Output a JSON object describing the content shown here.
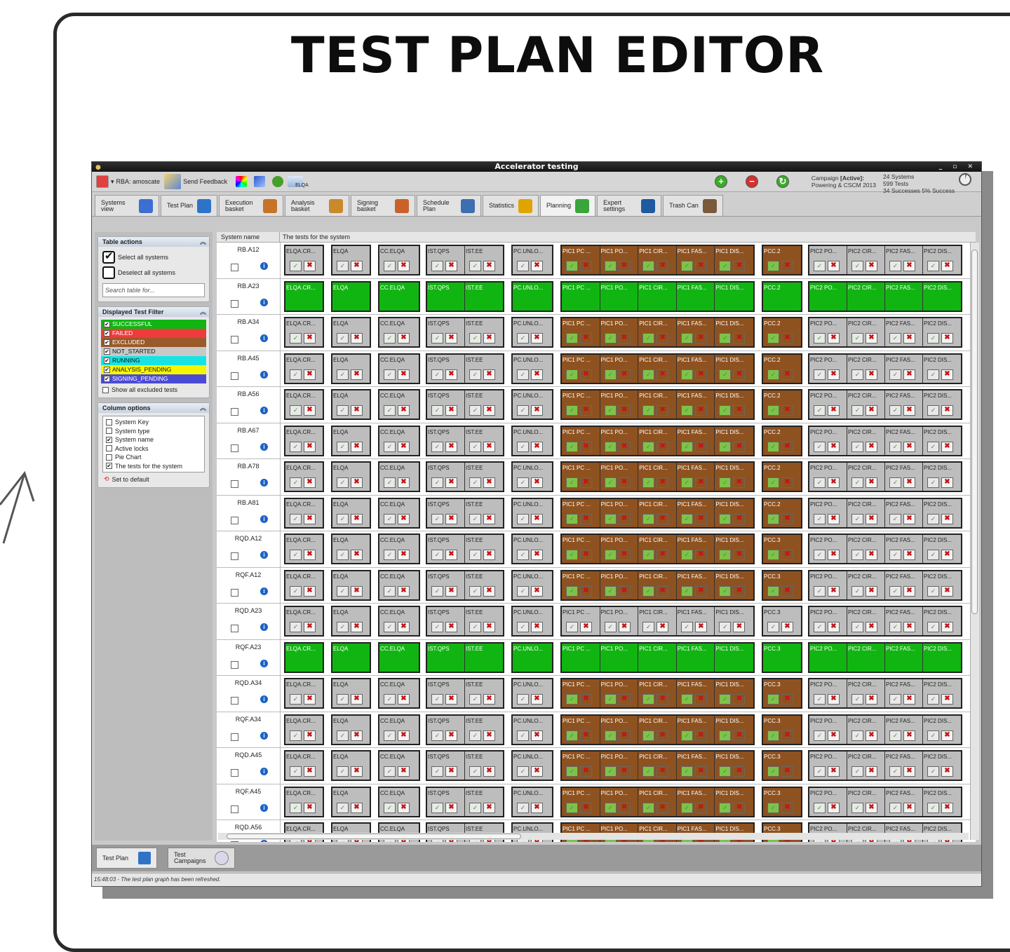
{
  "page_title": "TEST PLAN EDITOR",
  "window": {
    "title": "Accelerator testing",
    "controls": "_ ▫ ✕"
  },
  "toolbar": {
    "user": "RBA: amoscate",
    "send_feedback": "Send Feedback",
    "elqa": "ELQA",
    "campaign_label": "Campaign",
    "campaign_state": "[Active]:",
    "campaign_name": "Powering & CSCM 2013",
    "stats": {
      "systems": "24 Systems",
      "tests": "599 Tests",
      "successes": "34 Successes",
      "percent": "5% Success"
    }
  },
  "tabs": [
    {
      "label": "Systems view",
      "icon": "systems-view-icon",
      "color": "#3b6fd1"
    },
    {
      "label": "Test Plan",
      "icon": "test-plan-icon",
      "color": "#2f73c9"
    },
    {
      "label": "Execution basket",
      "icon": "execution-basket-icon",
      "color": "#c9722a"
    },
    {
      "label": "Analysis basket",
      "icon": "analysis-basket-icon",
      "color": "#c98a2a"
    },
    {
      "label": "Signing basket",
      "icon": "signing-basket-icon",
      "color": "#c9622a"
    },
    {
      "label": "Schedule Plan",
      "icon": "schedule-plan-icon",
      "color": "#3b6fb0"
    },
    {
      "label": "Statistics",
      "icon": "statistics-icon",
      "color": "#e0a400"
    },
    {
      "label": "Planning",
      "icon": "planning-icon",
      "color": "#3aa53a"
    },
    {
      "label": "Expert settings",
      "icon": "gear-icon",
      "color": "#1e5aa0"
    },
    {
      "label": "Trash Can",
      "icon": "trash-can-icon",
      "color": "#7a5a3a"
    }
  ],
  "table_actions": {
    "title": "Table actions",
    "select_all": "Select all systems",
    "deselect_all": "Deselect all systems",
    "search_placeholder": "Search table for..."
  },
  "test_filter": {
    "title": "Displayed Test Filter",
    "items": [
      {
        "label": "SUCCESSFUL",
        "color": "#11b511",
        "checked": true
      },
      {
        "label": "FAILED",
        "color": "#ef3b3b",
        "checked": true
      },
      {
        "label": "EXCLUDED",
        "color": "#9a5a2a",
        "checked": true
      },
      {
        "label": "NOT_STARTED",
        "color": "#c8c8c8",
        "checked": true
      },
      {
        "label": "RUNNING",
        "color": "#17e3e3",
        "checked": true
      },
      {
        "label": "ANALYSIS_PENDING",
        "color": "#f5f500",
        "checked": true
      },
      {
        "label": "SIGNING_PENDING",
        "color": "#4b4bd6",
        "checked": true
      }
    ],
    "show_excluded": "Show all excluded tests"
  },
  "column_options": {
    "title": "Column options",
    "items": [
      {
        "label": "System Key",
        "checked": false
      },
      {
        "label": "System type",
        "checked": false
      },
      {
        "label": "System name",
        "checked": true
      },
      {
        "label": "Active locks",
        "checked": false
      },
      {
        "label": "Pie Chart",
        "checked": false
      },
      {
        "label": "The tests for the system",
        "checked": true
      }
    ],
    "set_default": "Set to default"
  },
  "table": {
    "col_system": "System name",
    "col_tests": "The tests for the system",
    "rows": [
      {
        "name": "RB.A12",
        "state": "mixed"
      },
      {
        "name": "RB.A23",
        "state": "green"
      },
      {
        "name": "RB.A34",
        "state": "mixed"
      },
      {
        "name": "RB.A45",
        "state": "mixed"
      },
      {
        "name": "RB.A56",
        "state": "mixed"
      },
      {
        "name": "RB.A67",
        "state": "mixed"
      },
      {
        "name": "RB.A78",
        "state": "mixed"
      },
      {
        "name": "RB.A81",
        "state": "mixed"
      },
      {
        "name": "RQD.A12",
        "state": "mixed"
      },
      {
        "name": "RQF.A12",
        "state": "mixed"
      },
      {
        "name": "RQD.A23",
        "state": "grey"
      },
      {
        "name": "RQF.A23",
        "state": "green"
      },
      {
        "name": "RQD.A34",
        "state": "mixed"
      },
      {
        "name": "RQF.A34",
        "state": "mixed"
      },
      {
        "name": "RQD.A45",
        "state": "mixed"
      },
      {
        "name": "RQF.A45",
        "state": "mixed"
      },
      {
        "name": "RQD.A56",
        "state": "mixed"
      }
    ],
    "labels_rb": [
      "ELQA.CR...",
      "ELQA",
      "CC.ELQA",
      "IST.QPS",
      "IST.EE",
      "PC.UNLO...",
      "PIC1 PC ...",
      "PIC1 PO...",
      "PIC1 CIR...",
      "PIC1 FAS...",
      "PIC1 DIS...",
      "PCC.2",
      "PIC2 PO...",
      "PIC2 CIR...",
      "PIC2 FAS...",
      "PIC2 DIS..."
    ],
    "labels_rq": [
      "ELQA.CR...",
      "ELQA",
      "CC.ELQA",
      "IST.QPS",
      "IST.EE",
      "PC.UNLO...",
      "PIC1 PC ...",
      "PIC1 PO...",
      "PIC1 CIR...",
      "PIC1 FAS...",
      "PIC1 DIS...",
      "PCC.3",
      "PIC2 PO...",
      "PIC2 CIR...",
      "PIC2 FAS...",
      "PIC2 DIS..."
    ]
  },
  "bottom_tabs": [
    {
      "label": "Test Plan"
    },
    {
      "label": "Test Campaigns"
    }
  ],
  "status": "15:48:03 - The test plan graph has been refreshed."
}
